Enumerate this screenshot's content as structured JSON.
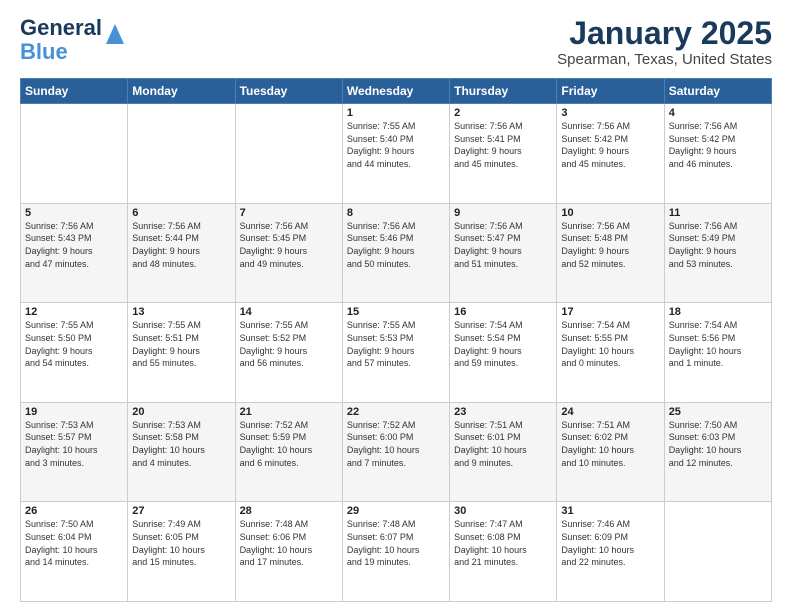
{
  "header": {
    "logo_general": "General",
    "logo_blue": "Blue",
    "title": "January 2025",
    "subtitle": "Spearman, Texas, United States"
  },
  "days_of_week": [
    "Sunday",
    "Monday",
    "Tuesday",
    "Wednesday",
    "Thursday",
    "Friday",
    "Saturday"
  ],
  "weeks": [
    [
      {
        "day": "",
        "content": ""
      },
      {
        "day": "",
        "content": ""
      },
      {
        "day": "",
        "content": ""
      },
      {
        "day": "1",
        "content": "Sunrise: 7:55 AM\nSunset: 5:40 PM\nDaylight: 9 hours\nand 44 minutes."
      },
      {
        "day": "2",
        "content": "Sunrise: 7:56 AM\nSunset: 5:41 PM\nDaylight: 9 hours\nand 45 minutes."
      },
      {
        "day": "3",
        "content": "Sunrise: 7:56 AM\nSunset: 5:42 PM\nDaylight: 9 hours\nand 45 minutes."
      },
      {
        "day": "4",
        "content": "Sunrise: 7:56 AM\nSunset: 5:42 PM\nDaylight: 9 hours\nand 46 minutes."
      }
    ],
    [
      {
        "day": "5",
        "content": "Sunrise: 7:56 AM\nSunset: 5:43 PM\nDaylight: 9 hours\nand 47 minutes."
      },
      {
        "day": "6",
        "content": "Sunrise: 7:56 AM\nSunset: 5:44 PM\nDaylight: 9 hours\nand 48 minutes."
      },
      {
        "day": "7",
        "content": "Sunrise: 7:56 AM\nSunset: 5:45 PM\nDaylight: 9 hours\nand 49 minutes."
      },
      {
        "day": "8",
        "content": "Sunrise: 7:56 AM\nSunset: 5:46 PM\nDaylight: 9 hours\nand 50 minutes."
      },
      {
        "day": "9",
        "content": "Sunrise: 7:56 AM\nSunset: 5:47 PM\nDaylight: 9 hours\nand 51 minutes."
      },
      {
        "day": "10",
        "content": "Sunrise: 7:56 AM\nSunset: 5:48 PM\nDaylight: 9 hours\nand 52 minutes."
      },
      {
        "day": "11",
        "content": "Sunrise: 7:56 AM\nSunset: 5:49 PM\nDaylight: 9 hours\nand 53 minutes."
      }
    ],
    [
      {
        "day": "12",
        "content": "Sunrise: 7:55 AM\nSunset: 5:50 PM\nDaylight: 9 hours\nand 54 minutes."
      },
      {
        "day": "13",
        "content": "Sunrise: 7:55 AM\nSunset: 5:51 PM\nDaylight: 9 hours\nand 55 minutes."
      },
      {
        "day": "14",
        "content": "Sunrise: 7:55 AM\nSunset: 5:52 PM\nDaylight: 9 hours\nand 56 minutes."
      },
      {
        "day": "15",
        "content": "Sunrise: 7:55 AM\nSunset: 5:53 PM\nDaylight: 9 hours\nand 57 minutes."
      },
      {
        "day": "16",
        "content": "Sunrise: 7:54 AM\nSunset: 5:54 PM\nDaylight: 9 hours\nand 59 minutes."
      },
      {
        "day": "17",
        "content": "Sunrise: 7:54 AM\nSunset: 5:55 PM\nDaylight: 10 hours\nand 0 minutes."
      },
      {
        "day": "18",
        "content": "Sunrise: 7:54 AM\nSunset: 5:56 PM\nDaylight: 10 hours\nand 1 minute."
      }
    ],
    [
      {
        "day": "19",
        "content": "Sunrise: 7:53 AM\nSunset: 5:57 PM\nDaylight: 10 hours\nand 3 minutes."
      },
      {
        "day": "20",
        "content": "Sunrise: 7:53 AM\nSunset: 5:58 PM\nDaylight: 10 hours\nand 4 minutes."
      },
      {
        "day": "21",
        "content": "Sunrise: 7:52 AM\nSunset: 5:59 PM\nDaylight: 10 hours\nand 6 minutes."
      },
      {
        "day": "22",
        "content": "Sunrise: 7:52 AM\nSunset: 6:00 PM\nDaylight: 10 hours\nand 7 minutes."
      },
      {
        "day": "23",
        "content": "Sunrise: 7:51 AM\nSunset: 6:01 PM\nDaylight: 10 hours\nand 9 minutes."
      },
      {
        "day": "24",
        "content": "Sunrise: 7:51 AM\nSunset: 6:02 PM\nDaylight: 10 hours\nand 10 minutes."
      },
      {
        "day": "25",
        "content": "Sunrise: 7:50 AM\nSunset: 6:03 PM\nDaylight: 10 hours\nand 12 minutes."
      }
    ],
    [
      {
        "day": "26",
        "content": "Sunrise: 7:50 AM\nSunset: 6:04 PM\nDaylight: 10 hours\nand 14 minutes."
      },
      {
        "day": "27",
        "content": "Sunrise: 7:49 AM\nSunset: 6:05 PM\nDaylight: 10 hours\nand 15 minutes."
      },
      {
        "day": "28",
        "content": "Sunrise: 7:48 AM\nSunset: 6:06 PM\nDaylight: 10 hours\nand 17 minutes."
      },
      {
        "day": "29",
        "content": "Sunrise: 7:48 AM\nSunset: 6:07 PM\nDaylight: 10 hours\nand 19 minutes."
      },
      {
        "day": "30",
        "content": "Sunrise: 7:47 AM\nSunset: 6:08 PM\nDaylight: 10 hours\nand 21 minutes."
      },
      {
        "day": "31",
        "content": "Sunrise: 7:46 AM\nSunset: 6:09 PM\nDaylight: 10 hours\nand 22 minutes."
      },
      {
        "day": "",
        "content": ""
      }
    ]
  ]
}
